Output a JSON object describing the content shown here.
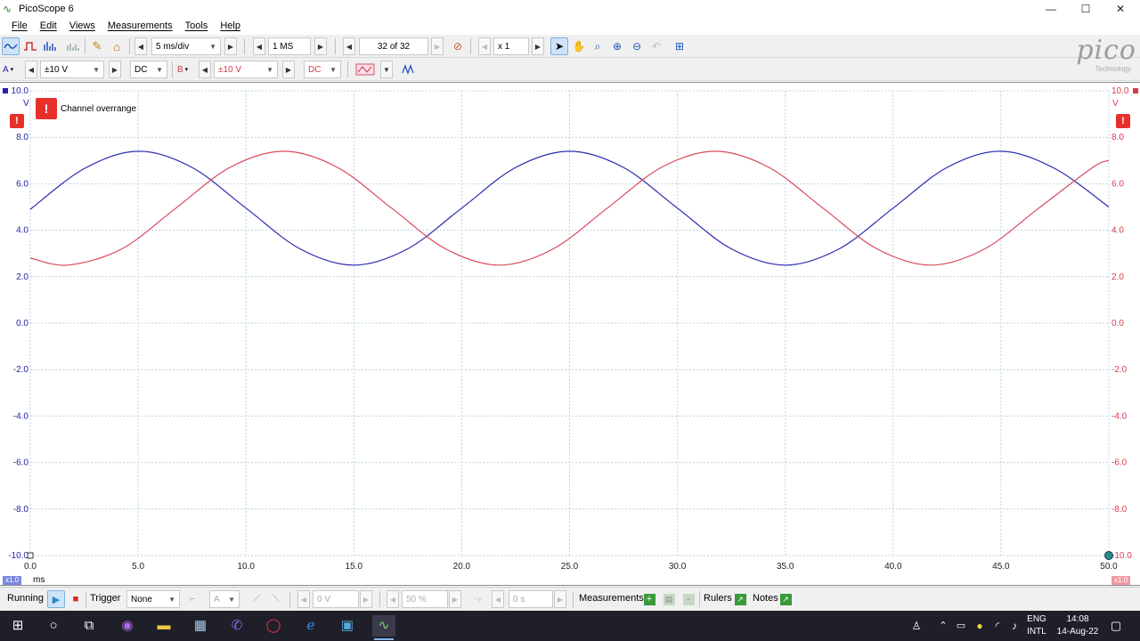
{
  "window": {
    "title": "PicoScope 6",
    "controls": {
      "minimize": "—",
      "maximize": "☐",
      "close": "✕"
    }
  },
  "menu": [
    "File",
    "Edit",
    "Views",
    "Measurements",
    "Tools",
    "Help"
  ],
  "toolbar1": {
    "timebase": "5 ms/div",
    "samples": "1 MS",
    "capture": "32 of 32",
    "zoom_factor": "x 1"
  },
  "toolbar2": {
    "channel_a": {
      "label": "A",
      "range": "±10 V",
      "coupling": "DC",
      "color": "#2222aa"
    },
    "channel_b": {
      "label": "B",
      "range": "±10 V",
      "coupling": "DC",
      "color": "#d33b4a"
    }
  },
  "logo": {
    "word": "pico",
    "sub": "Technology"
  },
  "scope": {
    "overrange_message": "Channel overrange",
    "overrange_icon": "!",
    "left_axis_unit": "V",
    "right_axis_unit": "V",
    "x_axis_unit": "ms",
    "scale_badge_left": "x1.0",
    "scale_badge_right": "x1.0"
  },
  "chart_data": {
    "type": "line",
    "xlim": [
      0,
      50
    ],
    "ylim": [
      -10,
      10
    ],
    "x_ticks": [
      "0.0",
      "5.0",
      "10.0",
      "15.0",
      "20.0",
      "25.0",
      "30.0",
      "35.0",
      "40.0",
      "45.0",
      "50.0"
    ],
    "y_ticks_left": [
      "10.0",
      "8.0",
      "6.0",
      "4.0",
      "2.0",
      "0.0",
      "-2.0",
      "-4.0",
      "-6.0",
      "-8.0",
      "-10.0"
    ],
    "y_ticks_right": [
      "10.0",
      "8.0",
      "6.0",
      "4.0",
      "2.0",
      "0.0",
      "-2.0",
      "-4.0",
      "-6.0",
      "-8.0",
      "-10.0"
    ],
    "grid": true,
    "series": [
      {
        "color": "#2b2bb0",
        "x": [
          0,
          2.5,
          5,
          7.5,
          10,
          12.5,
          15,
          17.5,
          20,
          22.5,
          25,
          27.5,
          30,
          32.5,
          35,
          37.5,
          40,
          42.5,
          45,
          47.5,
          50
        ],
        "values": [
          4.9,
          6.65,
          7.4,
          6.7,
          4.95,
          3.2,
          2.5,
          3.2,
          4.95,
          6.7,
          7.4,
          6.7,
          4.95,
          3.2,
          2.5,
          3.2,
          4.95,
          6.7,
          7.4,
          6.65,
          5.0
        ]
      },
      {
        "color": "#d94a5a",
        "x": [
          0,
          1.75,
          4.25,
          6.75,
          9.25,
          11.75,
          14.25,
          16.75,
          19.25,
          21.75,
          24.25,
          26.75,
          29.25,
          31.75,
          34.25,
          36.75,
          39.25,
          41.75,
          44.25,
          46.75,
          49.25,
          50
        ],
        "values": [
          2.8,
          2.5,
          3.2,
          4.95,
          6.7,
          7.4,
          6.7,
          4.95,
          3.2,
          2.5,
          3.2,
          4.95,
          6.7,
          7.4,
          6.7,
          4.95,
          3.2,
          2.5,
          3.2,
          4.95,
          6.7,
          7.0
        ]
      }
    ]
  },
  "bottombar": {
    "status": "Running",
    "trigger_label": "Trigger",
    "trigger_mode": "None",
    "trigger_source": "A",
    "trigger_level": "0 V",
    "pre_trigger": "50 %",
    "delay": "0 s",
    "measurements_label": "Measurements",
    "rulers_label": "Rulers",
    "notes_label": "Notes"
  },
  "taskbar": {
    "lang_top": "ENG",
    "lang_bottom": "INTL",
    "time": "14:08",
    "date": "14-Aug-22"
  }
}
